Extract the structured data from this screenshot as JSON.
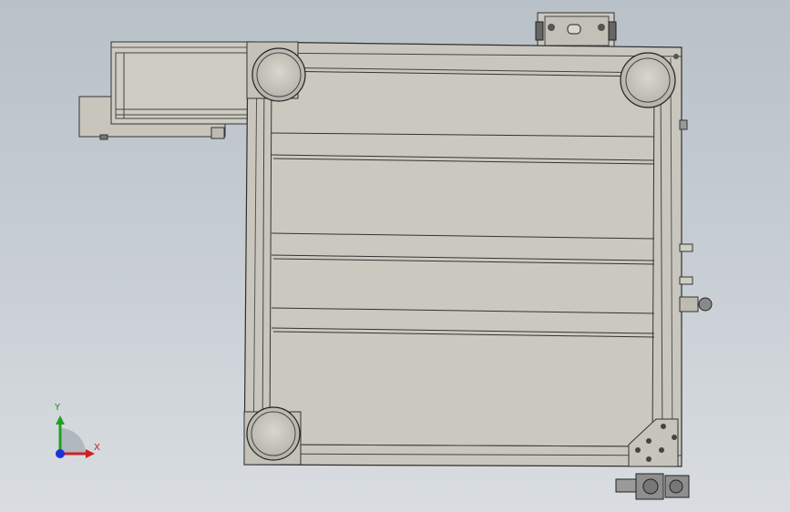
{
  "app": {
    "view": "cad-graphics-area"
  },
  "triad": {
    "x_label": "X",
    "y_label": "Y"
  },
  "colors": {
    "background_top": "#b9c1c8",
    "background_bottom": "#d9dde1",
    "frame_fill": "#c9c7bd",
    "frame_stroke": "#2f2f2f",
    "plate_fill": "#cbc9bf",
    "x_axis": "#d02020",
    "y_axis": "#22a022",
    "z_axis": "#1b33d6"
  }
}
